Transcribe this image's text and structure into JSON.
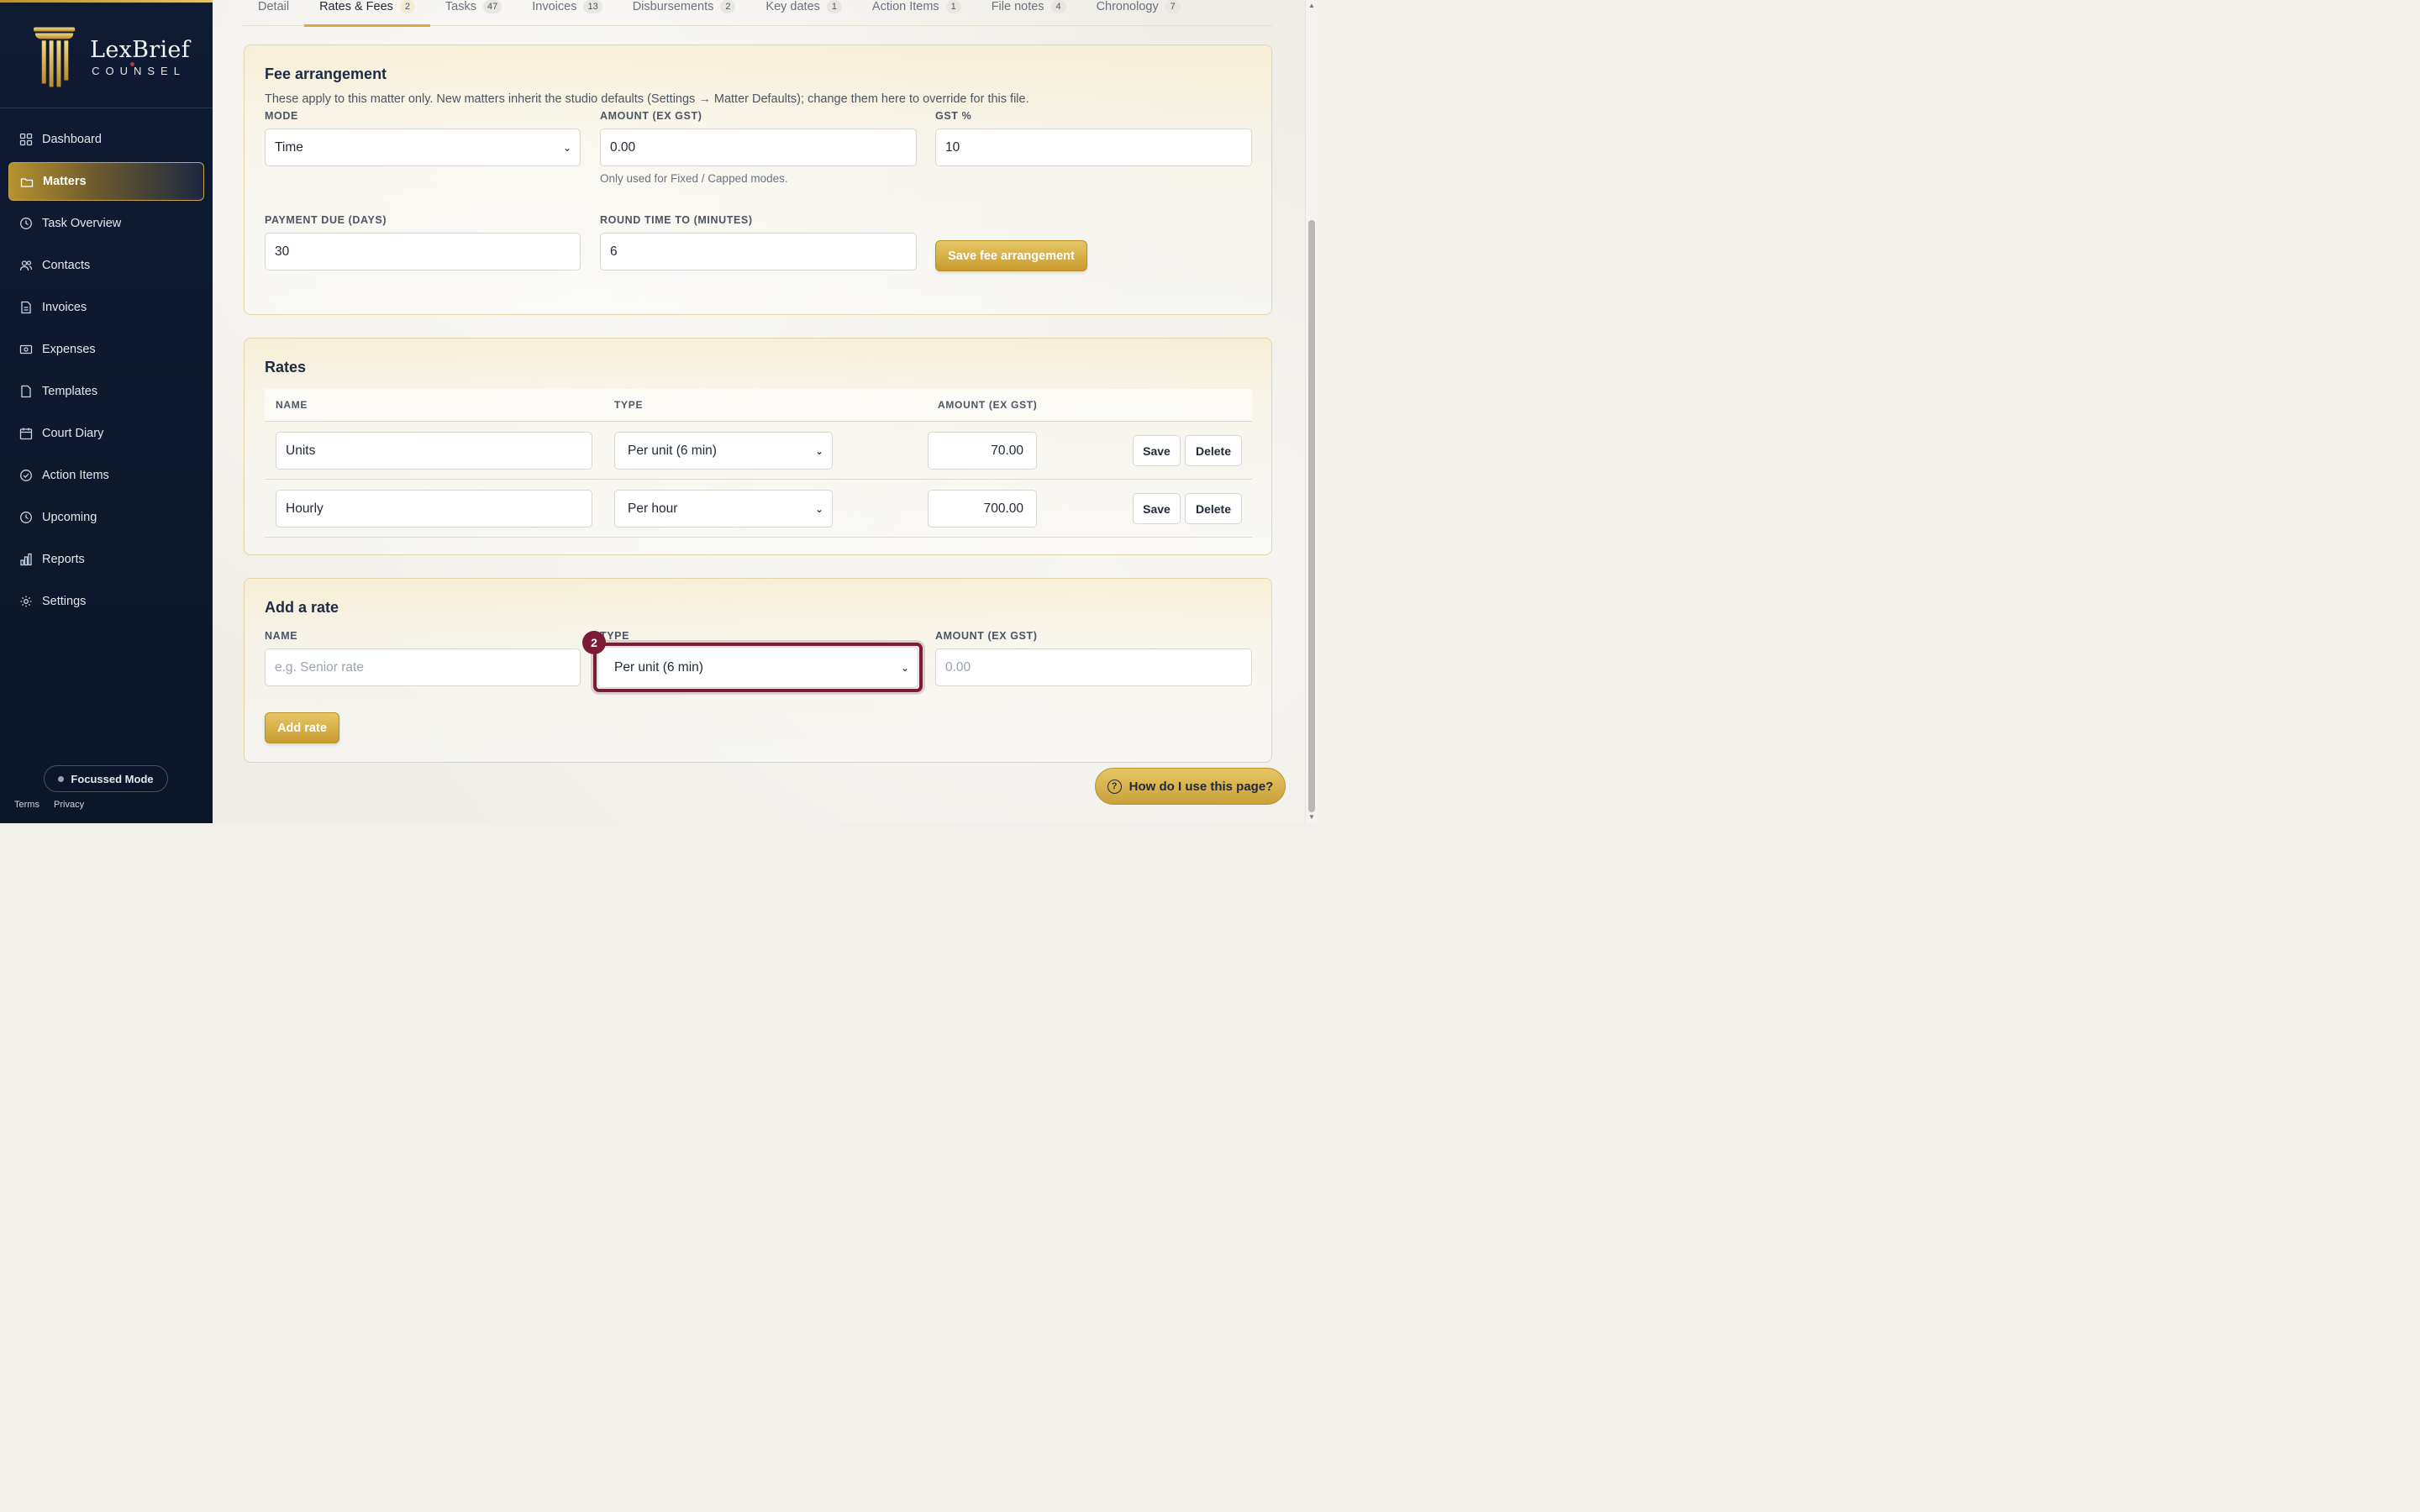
{
  "brand": {
    "name": "LexBrief",
    "sub": "COUNSEL"
  },
  "sidebar": {
    "items": [
      {
        "label": "Dashboard",
        "icon": "grid-icon"
      },
      {
        "label": "Matters",
        "icon": "folder-icon"
      },
      {
        "label": "Task Overview",
        "icon": "clock-icon"
      },
      {
        "label": "Contacts",
        "icon": "users-icon"
      },
      {
        "label": "Invoices",
        "icon": "file-text-icon"
      },
      {
        "label": "Expenses",
        "icon": "banknote-icon"
      },
      {
        "label": "Templates",
        "icon": "file-icon"
      },
      {
        "label": "Court Diary",
        "icon": "calendar-icon"
      },
      {
        "label": "Action Items",
        "icon": "check-circle-icon"
      },
      {
        "label": "Upcoming",
        "icon": "clock-icon"
      },
      {
        "label": "Reports",
        "icon": "bar-chart-icon"
      },
      {
        "label": "Settings",
        "icon": "gear-icon"
      }
    ],
    "active": "Matters",
    "focussed_mode": "Focussed Mode",
    "terms": "Terms",
    "privacy": "Privacy"
  },
  "tabs": [
    {
      "label": "Detail",
      "count": ""
    },
    {
      "label": "Rates & Fees",
      "count": "2"
    },
    {
      "label": "Tasks",
      "count": "47"
    },
    {
      "label": "Invoices",
      "count": "13"
    },
    {
      "label": "Disbursements",
      "count": "2"
    },
    {
      "label": "Key dates",
      "count": "1"
    },
    {
      "label": "Action Items",
      "count": "1"
    },
    {
      "label": "File notes",
      "count": "4"
    },
    {
      "label": "Chronology",
      "count": "7"
    }
  ],
  "fee": {
    "title": "Fee arrangement",
    "desc": "These apply to this matter only. New matters inherit the studio defaults (Settings → Matter Defaults); change them here to override for this file.",
    "mode_label": "MODE",
    "mode_value": "Time",
    "amount_label": "AMOUNT (EX GST)",
    "amount_value": "0.00",
    "amount_help": "Only used for Fixed / Capped modes.",
    "gst_label": "GST %",
    "gst_value": "10",
    "due_label": "PAYMENT DUE (DAYS)",
    "due_value": "30",
    "round_label": "ROUND TIME TO (MINUTES)",
    "round_value": "6",
    "save": "Save fee arrangement"
  },
  "rates": {
    "title": "Rates",
    "headers": {
      "name": "NAME",
      "type": "TYPE",
      "amount": "AMOUNT (EX GST)"
    },
    "rows": [
      {
        "name": "Units",
        "type": "Per unit (6 min)",
        "amount": "70.00"
      },
      {
        "name": "Hourly",
        "type": "Per hour",
        "amount": "700.00"
      }
    ],
    "save": "Save",
    "delete": "Delete"
  },
  "add": {
    "title": "Add a rate",
    "name_label": "NAME",
    "name_placeholder": "e.g. Senior rate",
    "type_label": "TYPE",
    "type_value": "Per unit (6 min)",
    "amount_label": "AMOUNT (EX GST)",
    "amount_placeholder": "0.00",
    "button": "Add rate",
    "badge": "2"
  },
  "help_button": "How do I use this page?",
  "colors": {
    "sidebar": "#0f1b33",
    "gold": "#d9ac3a",
    "focus": "#7a1c38"
  }
}
